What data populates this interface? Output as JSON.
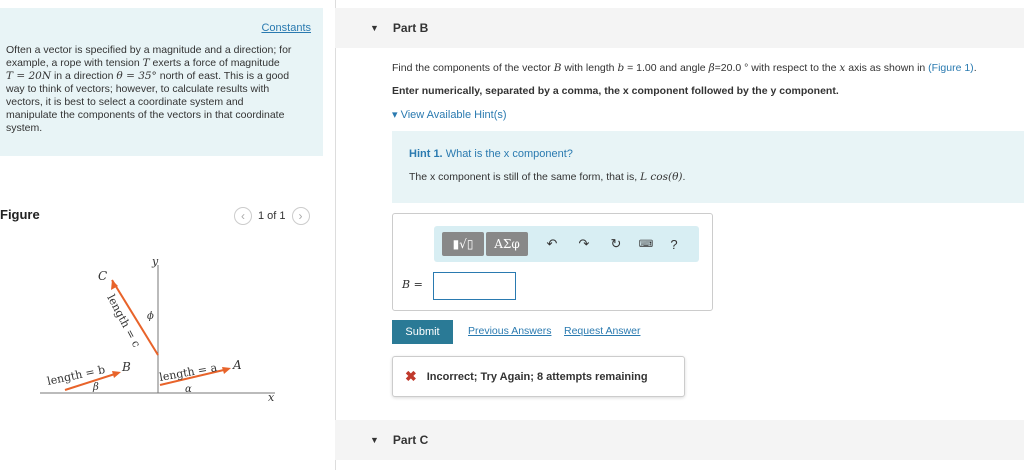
{
  "left": {
    "constants_label": "Constants",
    "intro_line1": "Often a vector is specified by a magnitude and a direction; for",
    "intro_line2_pre": "example, a rope with tension ",
    "intro_line2_sym": "T",
    "intro_line2_post": " exerts a force of magnitude",
    "intro_line3_math1": "T = 20N",
    "intro_line3_mid": " in a direction ",
    "intro_line3_math2": "θ = 35°",
    "intro_line3_post": " north of east. This is a good",
    "intro_line4": "way to think of vectors; however, to calculate results with",
    "intro_line5": "vectors, it is best to select a coordinate system and",
    "intro_line6": "manipulate the components of the vectors in that coordinate",
    "intro_line7": "system.",
    "figure_title": "Figure",
    "pager_text": "1 of 1",
    "figure": {
      "label_c": "C",
      "label_b": "B",
      "label_a": "A",
      "label_y": "y",
      "label_x": "x",
      "len_c": "length = c",
      "len_b": "length = b",
      "len_a": "length = a",
      "ang_phi": "ϕ",
      "ang_beta": "β",
      "ang_alpha": "α"
    }
  },
  "partB": {
    "label": "Part B",
    "question_pre": "Find the components of the vector ",
    "question_vec": "B",
    "question_mid1": " with length ",
    "question_math1": "b",
    "question_mid2": " = 1.00 and angle ",
    "question_math2": "β",
    "question_mid3": "=20.0 ° with respect to the ",
    "question_math3": "x",
    "question_mid4": " axis as shown in ",
    "question_link": "(Figure 1)",
    "question_end": ".",
    "instruction": "Enter numerically, separated by a comma, the x component followed by the y component.",
    "hints_link": "View Available Hint(s)",
    "hint_number": "Hint 1.",
    "hint_title": "What is the x component?",
    "hint_body_pre": "The x component is still of the same form, that is, ",
    "hint_body_math": "L cos(θ)",
    "hint_body_end": ".",
    "toolbar_templates": "√",
    "toolbar_greek": "ΑΣφ",
    "toolbar_help": "?",
    "answer_label": "B =",
    "answer_value": "",
    "submit_label": "Submit",
    "previous_answers": "Previous Answers",
    "request_answer": "Request Answer",
    "feedback": "Incorrect; Try Again; 8 attempts remaining"
  },
  "partC": {
    "label": "Part C"
  },
  "colors": {
    "accent": "#2a7ab0",
    "panel": "#e8f4f6",
    "submit": "#2a7a96",
    "error": "#c0392b",
    "vector": "#e8632a"
  }
}
